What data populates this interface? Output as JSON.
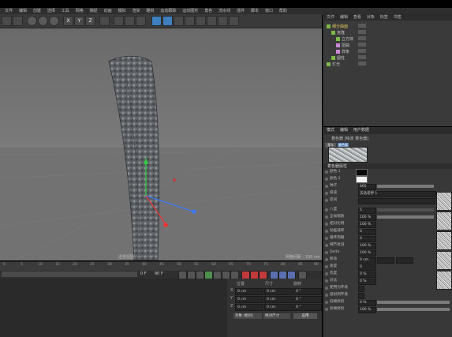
{
  "menubar": {
    "items": [
      "文件",
      "编辑",
      "创建",
      "选择",
      "工具",
      "网格",
      "捕捉",
      "动画",
      "模拟",
      "渲染",
      "雕刻",
      "运动跟踪",
      "运动图形",
      "角色",
      "流水线",
      "插件",
      "脚本",
      "窗口",
      "帮助"
    ]
  },
  "toolbar": {
    "buttons": [
      "undo",
      "redo",
      "move",
      "scale",
      "rotate",
      "x-axis",
      "y-axis",
      "z-axis",
      "coord-system",
      "render-view",
      "render-active",
      "render-settings",
      "cube",
      "pen",
      "subdivision",
      "array",
      "deformer",
      "scene",
      "camera",
      "light"
    ],
    "axis_labels": [
      "X",
      "Y",
      "Z"
    ]
  },
  "viewport": {
    "corner_label": "网格间距 : 100 cm",
    "view_label": "透视视图",
    "background": "#6c6c6c"
  },
  "timeline": {
    "ticks": [
      "0",
      "5",
      "10",
      "15",
      "20",
      "25",
      "30",
      "35",
      "40",
      "45",
      "50",
      "55",
      "60",
      "65",
      "70",
      "75",
      "80",
      "85",
      "90"
    ],
    "current_frame": "0 F",
    "end_frame": "90 F"
  },
  "transport": {
    "buttons": [
      "goto-start",
      "prev-key",
      "prev-frame",
      "play",
      "next-frame",
      "next-key",
      "goto-end",
      "record",
      "auto-key",
      "keyframe-selection"
    ]
  },
  "coordinates": {
    "columns": [
      "位置",
      "尺寸",
      "旋转"
    ],
    "rows": [
      {
        "axis": "X",
        "pos": "0 cm",
        "size": "0 cm",
        "rot": "0 °"
      },
      {
        "axis": "Y",
        "pos": "0 cm",
        "size": "0 cm",
        "rot": "0 °"
      },
      {
        "axis": "Z",
        "pos": "0 cm",
        "size": "0 cm",
        "rot": "0 °"
      }
    ],
    "mode_select": "对象 (相对)",
    "size_select": "绝对尺寸",
    "apply_button": "应用"
  },
  "object_manager": {
    "tabs": [
      "文件",
      "编辑",
      "查看",
      "对象",
      "标签",
      "书签"
    ],
    "objects": [
      {
        "name": "细分曲面",
        "color": "#7fb84a"
      },
      {
        "name": "克隆",
        "color": "#7fb84a"
      },
      {
        "name": "立方体",
        "color": "#7fb84a"
      },
      {
        "name": "扭曲",
        "color": "#c98ad6"
      },
      {
        "name": "样条",
        "color": "#c98ad6"
      },
      {
        "name": "圆柱",
        "color": "#7fb84a"
      },
      {
        "name": "灯光",
        "color": "#7fb84a"
      }
    ]
  },
  "attribute_manager": {
    "tabs": [
      "模式",
      "编辑",
      "用户数据"
    ],
    "material_name": "着色器 [噪波 着色器]",
    "buttons": [
      "基本",
      "着色器"
    ],
    "section": "着色器属性",
    "params": [
      {
        "label": "颜色 1",
        "value": ""
      },
      {
        "label": "颜色 2",
        "value": ""
      },
      {
        "label": "种子",
        "value": "665"
      },
      {
        "label": "噪波",
        "value": "沃洛诺伊 1"
      },
      {
        "label": "空间",
        "value": ""
      },
      {
        "label": "八度",
        "value": "5"
      },
      {
        "label": "全局缩放",
        "value": "100 %"
      },
      {
        "label": "相对比例",
        "value": "100 %"
      },
      {
        "label": "动画速率",
        "value": "0"
      },
      {
        "label": "循环周期",
        "value": "0"
      },
      {
        "label": "细节衰减",
        "value": "100 %"
      },
      {
        "label": "Delta",
        "value": "100 %"
      },
      {
        "label": "移动",
        "value": "0 cm"
      },
      {
        "label": "速度",
        "value": "0"
      },
      {
        "label": "亮度",
        "value": "0 %"
      },
      {
        "label": "对比",
        "value": "0 %"
      },
      {
        "label": "使用为环境",
        "value": ""
      },
      {
        "label": "投射到环境",
        "value": ""
      },
      {
        "label": "低端修剪",
        "value": "0 %"
      },
      {
        "label": "高端修剪",
        "value": "100 %"
      }
    ]
  }
}
